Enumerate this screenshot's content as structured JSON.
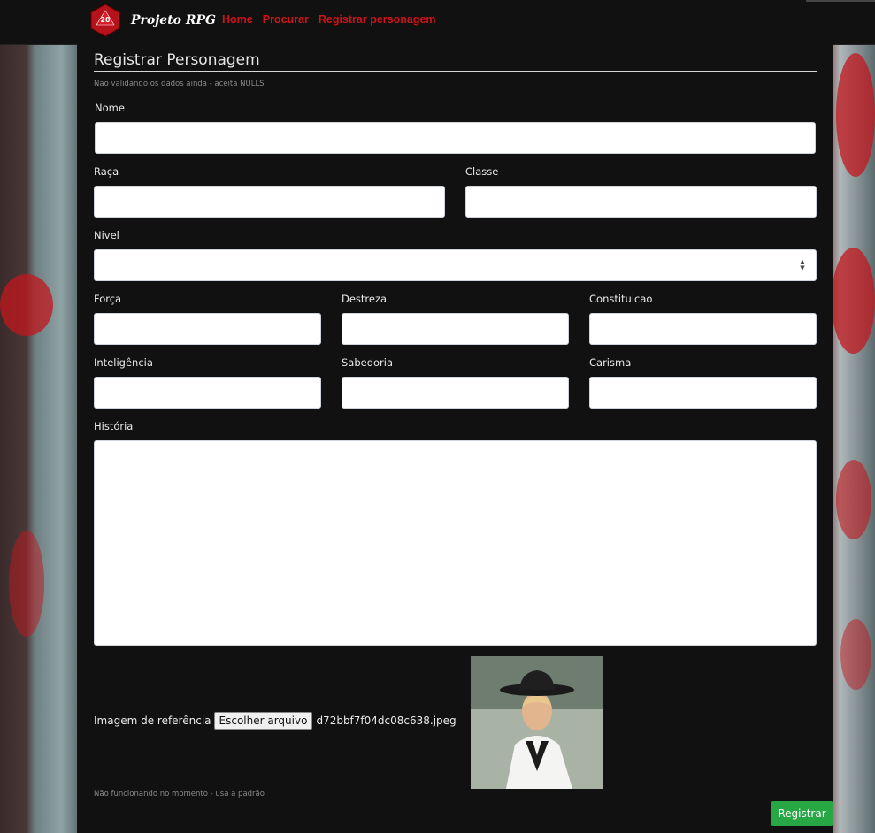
{
  "nav": {
    "brand_text": "Projeto RPG",
    "dice_number": "20",
    "links": [
      "Home",
      "Procurar",
      "Registrar personagem"
    ]
  },
  "form": {
    "title": "Registrar Personagem",
    "subtitle": "Não validando os dados ainda - aceita NULLS",
    "labels": {
      "nome": "Nome",
      "raca": "Raça",
      "classe": "Classe",
      "nivel": "Nivel",
      "forca": "Força",
      "destreza": "Destreza",
      "constituicao": "Constituicao",
      "inteligencia": "Inteligência",
      "sabedoria": "Sabedoria",
      "carisma": "Carisma",
      "historia": "História"
    },
    "values": {
      "nome": "",
      "raca": "",
      "classe": "",
      "nivel": "",
      "forca": "",
      "destreza": "",
      "constituicao": "",
      "inteligencia": "",
      "sabedoria": "",
      "carisma": "",
      "historia": ""
    },
    "image": {
      "label": "Imagem de referência",
      "button": "Escolher arquivo",
      "filename": "d72bbf7f04dc08c638.jpeg",
      "note": "Não funcionando no momento - usa a padrão"
    },
    "submit_label": "Registrar"
  },
  "colors": {
    "nav_link": "#d01219",
    "submit": "#28a745",
    "panel": "#111111"
  }
}
